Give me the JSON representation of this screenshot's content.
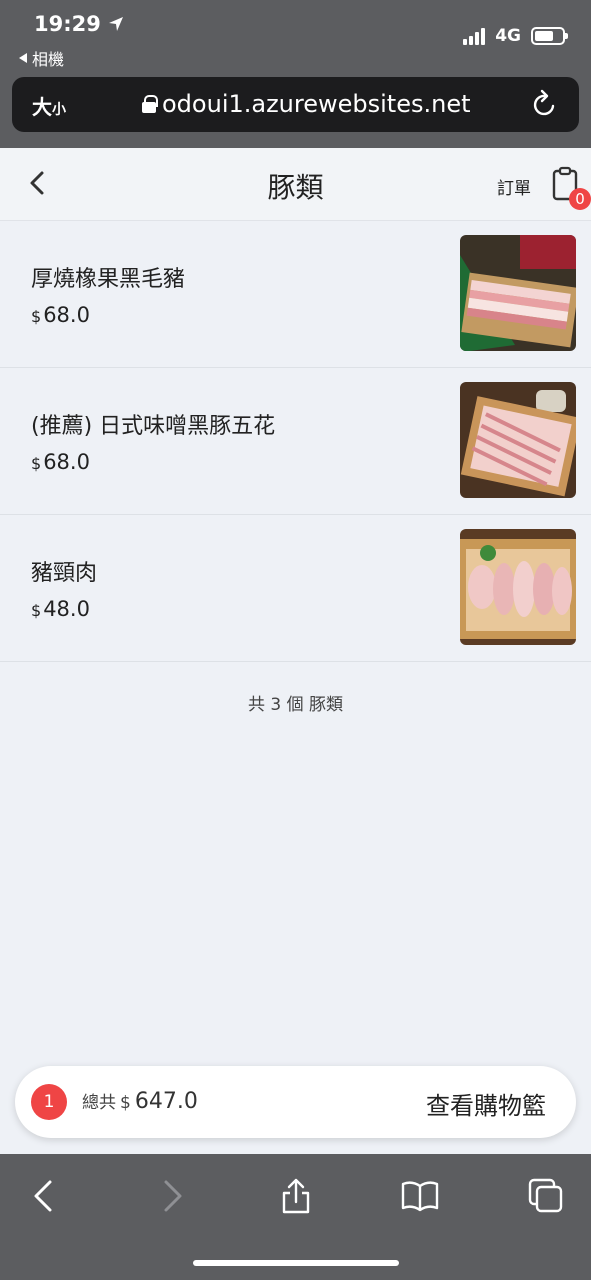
{
  "status": {
    "time": "19:29",
    "back_app": "相機",
    "network": "4G"
  },
  "urlbar": {
    "aa_big": "大",
    "aa_small": "小",
    "url": "odoui1.azurewebsites.net"
  },
  "header": {
    "title": "豚類",
    "order_label": "訂單",
    "order_badge": "0"
  },
  "items": [
    {
      "name": "厚燒橡果黑毛豬",
      "currency": "$",
      "price": "68.0"
    },
    {
      "name": "(推薦) 日式味噌黑豚五花",
      "currency": "$",
      "price": "68.0"
    },
    {
      "name": "豬頸肉",
      "currency": "$",
      "price": "48.0"
    }
  ],
  "footer_count": "共 3 個 豚類",
  "cart": {
    "count": "1",
    "total_label": "總共",
    "currency": "$",
    "total": "647.0",
    "button": "查看購物籃"
  },
  "colors": {
    "accent_red": "#ef4545",
    "chrome_gray": "#5c5d60",
    "page_bg": "#eef1f6"
  }
}
